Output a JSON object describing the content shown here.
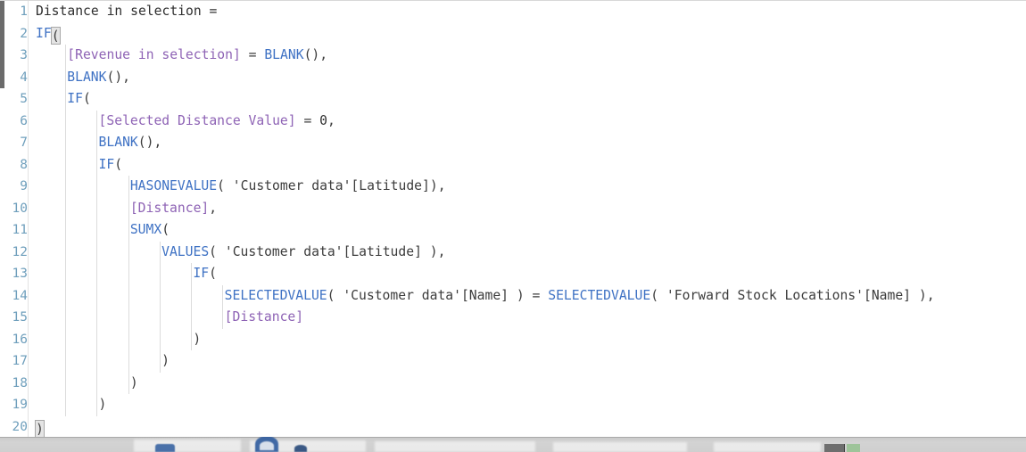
{
  "app": {
    "name": "dax-formula-editor",
    "measure_name": "Distance in selection"
  },
  "editor": {
    "font_size_px": 14.7,
    "line_height_px": 24.5,
    "total_lines": 20,
    "colors": {
      "background": "#ffffff",
      "gutter_text": "#6f9fbc",
      "function": "#3f72c4",
      "measure": "#8e63b5",
      "reference": "#3c3c3c",
      "punctuation": "#3c3c3c",
      "indent_guide": "#dcdcdc",
      "paren_match_bg": "#e4e4e4",
      "scrollbar_thumb": "#6b6b6b"
    },
    "indent_guide_x": [
      6,
      45,
      84,
      123,
      162,
      201
    ],
    "lines": [
      {
        "n": "1",
        "indent": 0,
        "tokens": [
          {
            "t": "plain",
            "v": "Distance in selection ="
          }
        ]
      },
      {
        "n": "2",
        "indent": 0,
        "tokens": [
          {
            "t": "fn",
            "v": "IF"
          },
          {
            "t": "paren-hl",
            "v": "("
          }
        ]
      },
      {
        "n": "3",
        "indent": 1,
        "tokens": [
          {
            "t": "meas",
            "v": "[Revenue in selection]"
          },
          {
            "t": "op",
            "v": " = "
          },
          {
            "t": "fn",
            "v": "BLANK"
          },
          {
            "t": "punc",
            "v": "(),"
          }
        ]
      },
      {
        "n": "4",
        "indent": 1,
        "tokens": [
          {
            "t": "fn",
            "v": "BLANK"
          },
          {
            "t": "punc",
            "v": "(),"
          }
        ]
      },
      {
        "n": "5",
        "indent": 1,
        "tokens": [
          {
            "t": "fn",
            "v": "IF"
          },
          {
            "t": "punc",
            "v": "("
          }
        ]
      },
      {
        "n": "6",
        "indent": 2,
        "tokens": [
          {
            "t": "meas",
            "v": "[Selected Distance Value]"
          },
          {
            "t": "op",
            "v": " = "
          },
          {
            "t": "num",
            "v": "0"
          },
          {
            "t": "punc",
            "v": ","
          }
        ]
      },
      {
        "n": "7",
        "indent": 2,
        "tokens": [
          {
            "t": "fn",
            "v": "BLANK"
          },
          {
            "t": "punc",
            "v": "(),"
          }
        ]
      },
      {
        "n": "8",
        "indent": 2,
        "tokens": [
          {
            "t": "fn",
            "v": "IF"
          },
          {
            "t": "punc",
            "v": "("
          }
        ]
      },
      {
        "n": "9",
        "indent": 3,
        "tokens": [
          {
            "t": "fn",
            "v": "HASONEVALUE"
          },
          {
            "t": "punc",
            "v": "( "
          },
          {
            "t": "ref",
            "v": "'Customer data'[Latitude]"
          },
          {
            "t": "punc",
            "v": "),"
          }
        ]
      },
      {
        "n": "10",
        "indent": 3,
        "tokens": [
          {
            "t": "meas",
            "v": "[Distance]"
          },
          {
            "t": "punc",
            "v": ","
          }
        ]
      },
      {
        "n": "11",
        "indent": 3,
        "tokens": [
          {
            "t": "fn",
            "v": "SUMX"
          },
          {
            "t": "punc",
            "v": "("
          }
        ]
      },
      {
        "n": "12",
        "indent": 4,
        "tokens": [
          {
            "t": "fn",
            "v": "VALUES"
          },
          {
            "t": "punc",
            "v": "( "
          },
          {
            "t": "ref",
            "v": "'Customer data'[Latitude]"
          },
          {
            "t": "punc",
            "v": " ),"
          }
        ]
      },
      {
        "n": "13",
        "indent": 5,
        "tokens": [
          {
            "t": "fn",
            "v": "IF"
          },
          {
            "t": "punc",
            "v": "("
          }
        ]
      },
      {
        "n": "14",
        "indent": 6,
        "tokens": [
          {
            "t": "fn",
            "v": "SELECTEDVALUE"
          },
          {
            "t": "punc",
            "v": "( "
          },
          {
            "t": "ref",
            "v": "'Customer data'[Name]"
          },
          {
            "t": "punc",
            "v": " )"
          },
          {
            "t": "op",
            "v": " = "
          },
          {
            "t": "fn",
            "v": "SELECTEDVALUE"
          },
          {
            "t": "punc",
            "v": "( "
          },
          {
            "t": "ref",
            "v": "'Forward Stock Locations'[Name]"
          },
          {
            "t": "punc",
            "v": " ),"
          }
        ]
      },
      {
        "n": "15",
        "indent": 6,
        "tokens": [
          {
            "t": "meas",
            "v": "[Distance]"
          }
        ]
      },
      {
        "n": "16",
        "indent": 5,
        "tokens": [
          {
            "t": "punc",
            "v": ")"
          }
        ]
      },
      {
        "n": "17",
        "indent": 4,
        "tokens": [
          {
            "t": "punc",
            "v": ")"
          }
        ]
      },
      {
        "n": "18",
        "indent": 3,
        "tokens": [
          {
            "t": "punc",
            "v": ")"
          }
        ]
      },
      {
        "n": "19",
        "indent": 2,
        "tokens": [
          {
            "t": "punc",
            "v": ")"
          }
        ]
      },
      {
        "n": "20",
        "indent": 0,
        "tokens": [
          {
            "t": "paren-hl",
            "v": ")"
          }
        ]
      }
    ]
  },
  "taskbar": {
    "visible_sliver": true,
    "icons": [
      "folder-icon",
      "browser-icon",
      "app-icon"
    ]
  }
}
